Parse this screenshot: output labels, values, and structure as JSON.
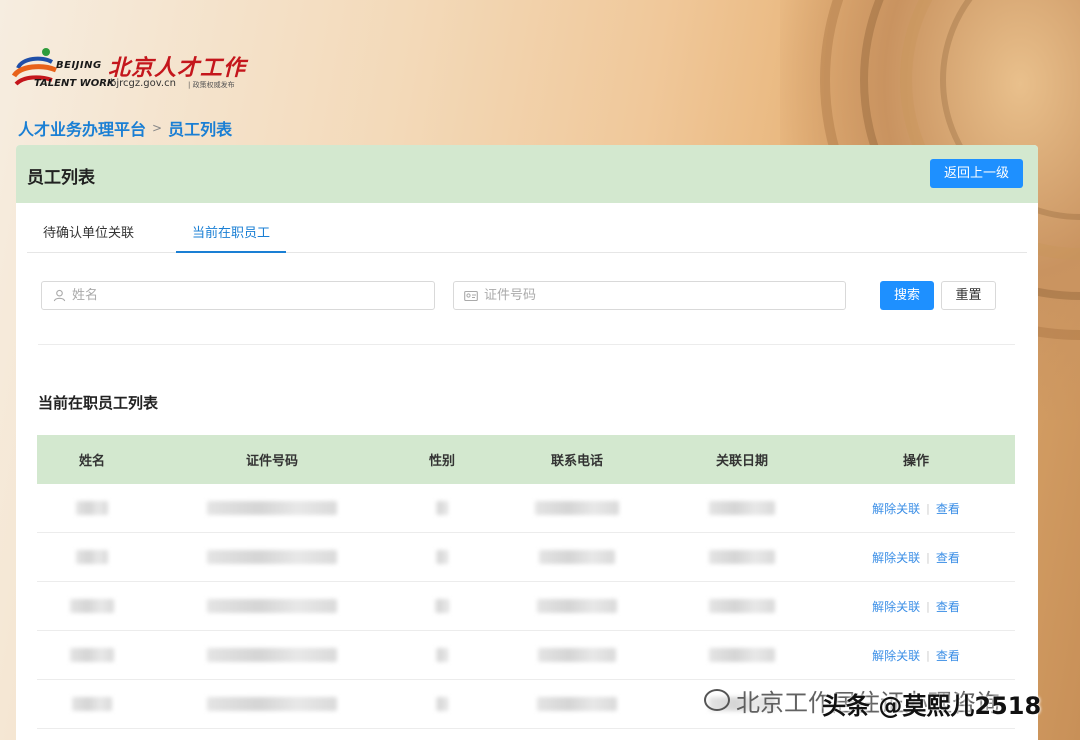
{
  "logo": {
    "en_line1": "BEIJING",
    "en_line2": "TALENT WORK",
    "cn": "北京人才工作",
    "url": "bjrcgz.gov.cn",
    "sub": "| 政策权威发布"
  },
  "breadcrumb": {
    "root": "人才业务办理平台",
    "separator": ">",
    "current": "员工列表"
  },
  "panel": {
    "title": "员工列表",
    "back_label": "返回上一级"
  },
  "tabs": [
    {
      "label": "待确认单位关联",
      "active": false
    },
    {
      "label": "当前在职员工",
      "active": true
    }
  ],
  "search": {
    "name_placeholder": "姓名",
    "id_placeholder": "证件号码",
    "search_label": "搜索",
    "reset_label": "重置"
  },
  "list_title": "当前在职员工列表",
  "table": {
    "columns": [
      "姓名",
      "证件号码",
      "性别",
      "联系电话",
      "关联日期",
      "操作"
    ],
    "rows": [
      {
        "unlink": "解除关联",
        "view": "查看"
      },
      {
        "unlink": "解除关联",
        "view": "查看"
      },
      {
        "unlink": "解除关联",
        "view": "查看"
      },
      {
        "unlink": "解除关联",
        "view": "查看"
      },
      {
        "unlink": "",
        "view": ""
      }
    ]
  },
  "watermark": {
    "text": "北京工作居住证办理咨询",
    "overlay": "头条 @莫熙儿2518"
  },
  "colors": {
    "accent": "#1e90ff",
    "header_green": "#d3e8cf",
    "link": "#3a8ee6",
    "logo_red": "#c4161c"
  }
}
